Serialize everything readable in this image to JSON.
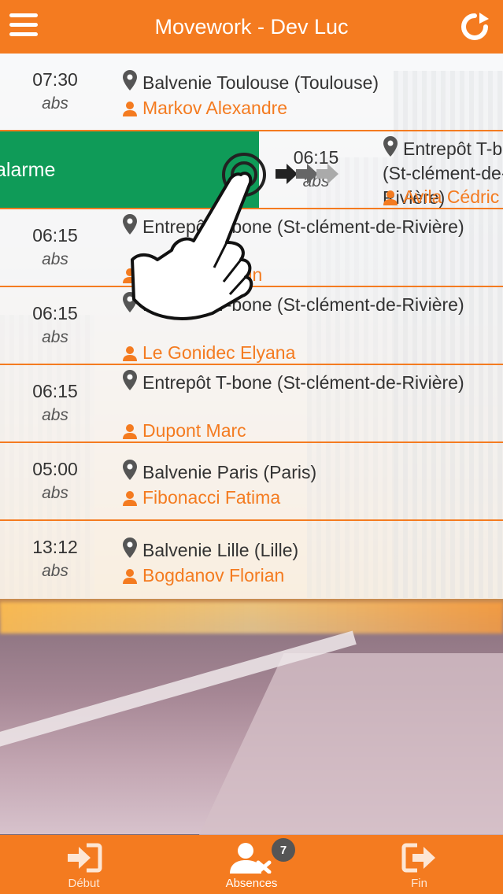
{
  "header": {
    "title": "Movework - Dev Luc",
    "menu_icon": "hamburger-menu-icon",
    "refresh_icon": "refresh-icon",
    "color": "#f47b20"
  },
  "rows": [
    {
      "time": "07:30",
      "status": "abs",
      "location": "Balvenie Toulouse (Toulouse)",
      "person": "Markov Alexandre"
    },
    {
      "time": "06:15",
      "status": "abs",
      "location": "Entrepôt T-bone (St-clément-de-Rivière)",
      "person": "Avila Cédric",
      "swipe_action": "alarme"
    },
    {
      "time": "06:15",
      "status": "abs",
      "location": "Entrepôt T-bone (St-clément-de-Rivière)",
      "person": "Huin"
    },
    {
      "time": "06:15",
      "status": "abs",
      "location": "Entrepôt T-bone (St-clément-de-Rivière)",
      "person": "Le Gonidec Elyana"
    },
    {
      "time": "06:15",
      "status": "abs",
      "location": "Entrepôt T-bone (St-clément-de-Rivière)",
      "person": "Dupont Marc"
    },
    {
      "time": "05:00",
      "status": "abs",
      "location": "Balvenie Paris (Paris)",
      "person": "Fibonacci Fatima"
    },
    {
      "time": "13:12",
      "status": "abs",
      "location": "Balvenie Lille (Lille)",
      "person": "Bogdanov Florian"
    }
  ],
  "tabs": [
    {
      "label": "Début",
      "icon": "sign-in-icon"
    },
    {
      "label": "Absences",
      "icon": "user-absent-icon",
      "badge": "7",
      "active": true
    },
    {
      "label": "Fin",
      "icon": "sign-out-icon"
    }
  ],
  "colors": {
    "accent": "#f47b20",
    "swipe_green": "#0f9b58"
  }
}
